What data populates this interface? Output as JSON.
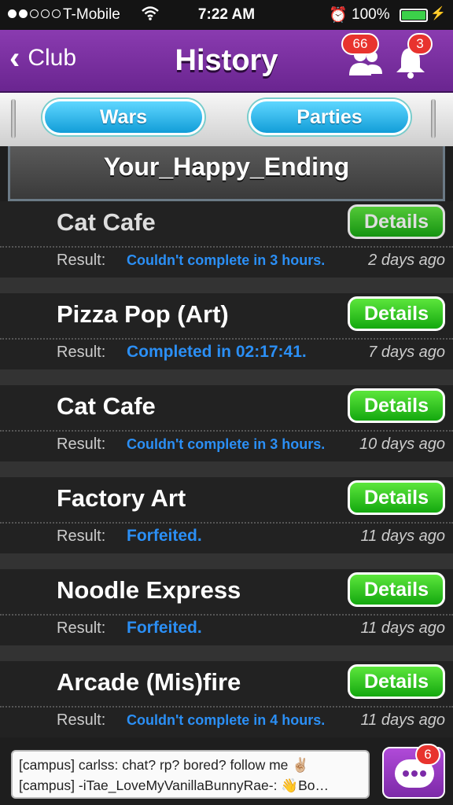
{
  "status_bar": {
    "carrier": "T-Mobile",
    "time": "7:22 AM",
    "battery_pct": "100%"
  },
  "header": {
    "back_label": "Club",
    "title": "History",
    "friends_badge": "66",
    "notifications_badge": "3"
  },
  "tabs": {
    "wars": "Wars",
    "parties": "Parties"
  },
  "club_name": "Your_Happy_Ending",
  "history": [
    {
      "name": "Cat Cafe",
      "details": "Details",
      "result_label": "Result:",
      "result": "Couldn't complete in 3 hours.",
      "ago": "2 days ago"
    },
    {
      "name": "Pizza Pop (Art)",
      "details": "Details",
      "result_label": "Result:",
      "result": "Completed in 02:17:41.",
      "ago": "7 days ago"
    },
    {
      "name": "Cat Cafe",
      "details": "Details",
      "result_label": "Result:",
      "result": "Couldn't complete in 3 hours.",
      "ago": "10 days ago"
    },
    {
      "name": "Factory Art",
      "details": "Details",
      "result_label": "Result:",
      "result": "Forfeited.",
      "ago": "11 days ago"
    },
    {
      "name": "Noodle Express",
      "details": "Details",
      "result_label": "Result:",
      "result": "Forfeited.",
      "ago": "11 days ago"
    },
    {
      "name": "Arcade (Mis)fire",
      "details": "Details",
      "result_label": "Result:",
      "result": "Couldn't complete in 4 hours.",
      "ago": "11 days ago"
    }
  ],
  "chat": {
    "line1": "[campus] carlss: chat? rp? bored? follow me ✌🏼",
    "line2": "[campus] -iTae_LoveMyVanillaBunnyRae-: 👋Bo…",
    "badge": "6"
  },
  "colors": {
    "header_purple": "#7a2fa0",
    "tab_blue": "#2bb6ee",
    "details_green": "#2fcf1f",
    "result_blue": "#2b8ff5",
    "badge_red": "#e8332e"
  }
}
